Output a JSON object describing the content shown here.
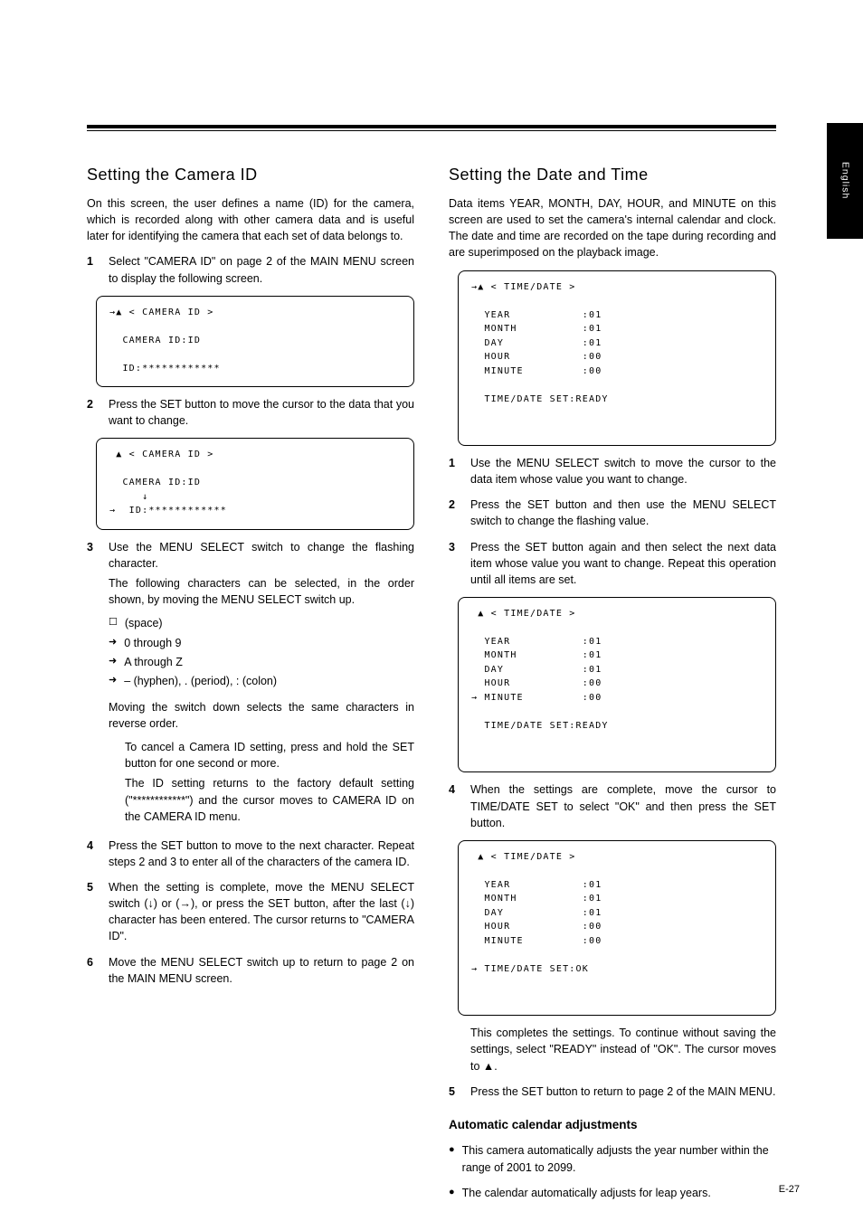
{
  "tab_label": "English",
  "page_number": "E-27",
  "left": {
    "heading": "Setting the Camera ID",
    "intro": "On this screen, the user defines a name (ID) for the camera, which is recorded along with other camera data and is useful later for identifying the camera that each set of data belongs to.",
    "step1": {
      "n": "1",
      "text": "Select \"CAMERA ID\" on page 2 of the MAIN MENU screen to display the following screen."
    },
    "box1": {
      "title": "→▲ < CAMERA ID >",
      "line1": "  CAMERA ID:ID",
      "line2": "  ID:************"
    },
    "step2": {
      "n": "2",
      "text": "Press the SET button to move the cursor to the data that you want to change."
    },
    "box2": {
      "title": " ▲ < CAMERA ID >",
      "line1": "  CAMERA ID:ID",
      "line2": "     ↓",
      "line3": "→  ID:************"
    },
    "step3": {
      "n": "3",
      "pre": "Use the MENU SELECT switch to change the flashing character.",
      "text": "The following characters can be selected, in the order shown, by moving the MENU SELECT switch up.",
      "row1_glyph": "   ☐",
      "row1_txt": "(space)",
      "row2_glyph": "➜",
      "row2_txt": "0 through 9",
      "row3_glyph": "➜",
      "row3_txt": "A through Z",
      "row4_glyph": "➜",
      "row4_txt": "– (hyphen), . (period), : (colon)",
      "after": "Moving the switch down selects the same characters in reverse order.",
      "note_l1": "To cancel a Camera ID setting, press and hold the SET button for one second or more.",
      "note_l2": "The ID setting returns to the factory default setting (\"************\") and the cursor moves to CAMERA ID on the CAMERA ID menu."
    },
    "step4": {
      "n": "4",
      "text": "Press the SET button to move to the next character. Repeat steps 2 and 3 to enter all of the characters of the camera ID."
    },
    "step5": {
      "n": "5",
      "text": "When the setting is complete, move the MENU SELECT switch (↓) or (→), or press the SET button, after the last (↓) character has been entered. The cursor returns to \"CAMERA ID\"."
    },
    "step6": {
      "n": "6",
      "text": "Move the MENU SELECT switch up to return to page 2 on the MAIN MENU screen."
    }
  },
  "right": {
    "heading_a": "Setting the Date and Time",
    "intro_a": "Data items YEAR, MONTH, DAY, HOUR, and MINUTE on this screen are used to set the camera's internal calendar and clock. The date and time are recorded on the tape during recording and are superimposed on the playback image.",
    "box_a": {
      "title": "→▲ < TIME/DATE >",
      "l1": "  YEAR           :01",
      "l2": "  MONTH          :01",
      "l3": "  DAY            :01",
      "l4": "  HOUR           :00",
      "l5": "  MINUTE         :00",
      "l6": "",
      "l7": "  TIME/DATE SET:READY"
    },
    "step_a1": {
      "n": "1",
      "text": "Use the MENU SELECT switch to move the cursor to the data item whose value you want to change."
    },
    "step_a2": {
      "n": "2",
      "text": "Press the SET button and then use the MENU SELECT switch to change the flashing value."
    },
    "step_a3": {
      "n": "3",
      "text": "Press the SET button again and then select the next data item whose value you want to change. Repeat this operation until all items are set."
    },
    "box_b": {
      "title": " ▲ < TIME/DATE >",
      "l1": "  YEAR           :01",
      "l2": "  MONTH          :01",
      "l3": "  DAY            :01",
      "l4": "  HOUR           :00",
      "l5": "→ MINUTE         :00",
      "l6": "",
      "l7": "  TIME/DATE SET:READY"
    },
    "step_a4": {
      "n": "4",
      "text": "When the settings are complete, move the cursor to TIME/DATE SET to select \"OK\" and then press the SET button."
    },
    "box_c": {
      "title": " ▲ < TIME/DATE >",
      "l1": "  YEAR           :01",
      "l2": "  MONTH          :01",
      "l3": "  DAY            :01",
      "l4": "  HOUR           :00",
      "l5": "  MINUTE         :00",
      "l6": "",
      "l7": "→ TIME/DATE SET:OK"
    },
    "after_c": "This completes the settings. To continue without saving the settings, select \"READY\" instead of \"OK\". The cursor moves to ▲.",
    "step_a5": {
      "n": "5",
      "text": "Press the SET button to return to page 2 of the MAIN MENU."
    },
    "heading_b": "Automatic calendar adjustments",
    "bul1": "This camera automatically adjusts the year number within the range of 2001 to 2099.",
    "bul2": "The calendar automatically adjusts for leap years."
  }
}
